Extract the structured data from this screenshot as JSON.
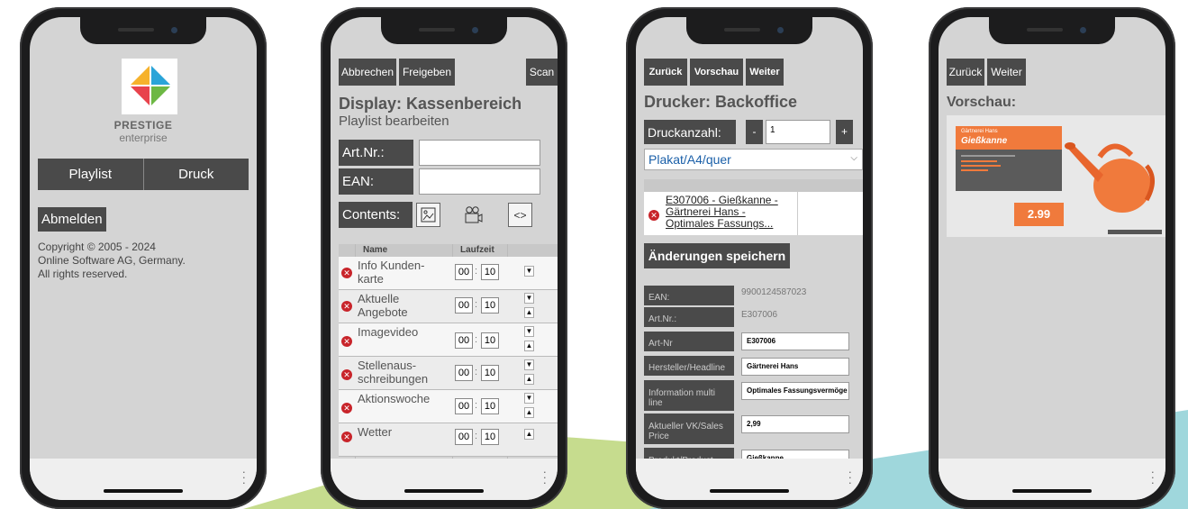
{
  "colors": {
    "button": "#4a4a4a",
    "delete": "#c8242a",
    "link": "#1a5fa8",
    "poster": "#f07a3c"
  },
  "phone1": {
    "brand": "PRESTIGE",
    "brand_sub": "enterprise",
    "nav": [
      "Playlist",
      "Druck"
    ],
    "logout": "Abmelden",
    "copyright": [
      "Copyright © 2005 - 2024",
      "Online Software AG, Germany.",
      "All rights reserved."
    ]
  },
  "phone2": {
    "toolbar": {
      "cancel": "Abbrechen",
      "release": "Freigeben",
      "scan": "Scan"
    },
    "title": "Display: Kassenbereich",
    "subtitle": "Playlist bearbeiten",
    "art_label": "Art.Nr.:",
    "art_value": "",
    "ean_label": "EAN:",
    "ean_value": "",
    "contents_label": "Contents:",
    "icons": [
      "image-icon",
      "video-icon",
      "code-icon"
    ],
    "col_name": "Name",
    "col_runtime": "Laufzeit",
    "rows": [
      {
        "name": "Info Kunden-karte",
        "m": "00",
        "s": "10"
      },
      {
        "name": "Aktuelle Angebote",
        "m": "00",
        "s": "10"
      },
      {
        "name": "Imagevideo",
        "m": "00",
        "s": "10"
      },
      {
        "name": "Stellenaus-schreibungen",
        "m": "00",
        "s": "10"
      },
      {
        "name": "Aktionswoche",
        "m": "00",
        "s": "10"
      },
      {
        "name": "Wetter",
        "m": "00",
        "s": "10"
      }
    ],
    "colon": ":"
  },
  "phone3": {
    "toolbar": {
      "back": "Zurück",
      "preview": "Vorschau",
      "next": "Weiter"
    },
    "title": "Drucker: Backoffice",
    "count_label": "Druckanzahl:",
    "minus": "-",
    "count_value": "1",
    "plus": "+",
    "format": "Plakat/A4/quer",
    "item_text": "E307006 - Gießkanne - Gärtnerei Hans - Optimales Fassungs...",
    "save": "Änderungen speichern",
    "fields": [
      {
        "label": "EAN:",
        "value": "9900124587023",
        "input": false
      },
      {
        "label": "Art.Nr.:",
        "value": "E307006",
        "input": false
      },
      {
        "label": "Art-Nr",
        "value": "E307006",
        "input": true
      },
      {
        "label": "Hersteller/Headline",
        "value": "Gärtnerei Hans",
        "input": true
      },
      {
        "label": "Information multi line",
        "value": "Optimales Fassungsvermöge",
        "input": true
      },
      {
        "label": "Aktueller VK/Sales Price",
        "value": "2,99",
        "input": true
      },
      {
        "label": "Produkt/Product ARTS",
        "value": "Gießkanne",
        "input": true
      }
    ]
  },
  "phone4": {
    "toolbar": {
      "back": "Zurück",
      "next": "Weiter"
    },
    "title": "Vorschau:",
    "poster": {
      "brand": "Gärtnerei Hans",
      "product": "Gießkanne",
      "price": "2.99"
    }
  }
}
